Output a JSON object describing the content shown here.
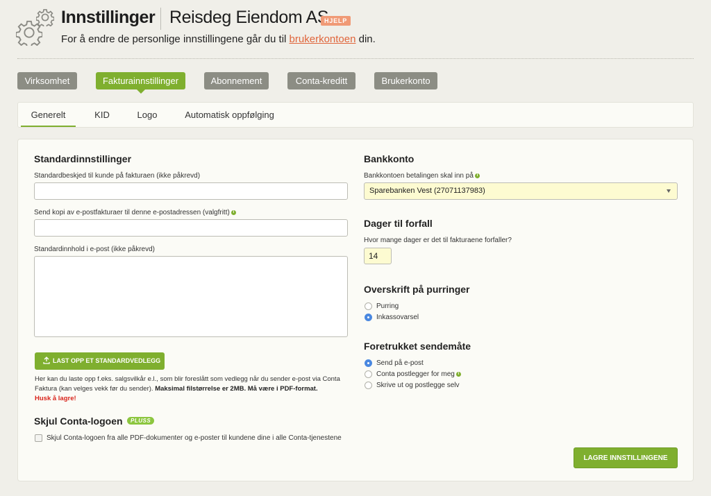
{
  "header": {
    "title": "Innstillinger",
    "company": "Reisdeg Eiendom AS",
    "help_badge": "HJELP",
    "subtitle_before": "For å endre de personlige innstillingene går du til ",
    "subtitle_link": "brukerkontoen",
    "subtitle_after": " din."
  },
  "main_tabs": [
    {
      "label": "Virksomhet",
      "active": false
    },
    {
      "label": "Fakturainnstillinger",
      "active": true
    },
    {
      "label": "Abonnement",
      "active": false
    },
    {
      "label": "Conta-kreditt",
      "active": false
    },
    {
      "label": "Brukerkonto",
      "active": false
    }
  ],
  "sub_tabs": [
    {
      "label": "Generelt",
      "active": true
    },
    {
      "label": "KID",
      "active": false
    },
    {
      "label": "Logo",
      "active": false
    },
    {
      "label": "Automatisk oppfølging",
      "active": false
    }
  ],
  "left": {
    "heading": "Standardinnstillinger",
    "message_label": "Standardbeskjed til kunde på fakturaen (ikke påkrevd)",
    "message_value": "",
    "copy_label": "Send kopi av e-postfakturaer til denne e-postadressen (valgfritt)",
    "copy_value": "",
    "content_label": "Standardinnhold i e-post (ikke påkrevd)",
    "content_value": "",
    "upload_button": "LAST OPP ET STANDARDVEDLEGG",
    "hint_text": "Her kan du laste opp f.eks. salgsvilkår e.l., som blir foreslått som vedlegg når du sender e-post via Conta Faktura (kan velges vekk før du sender). ",
    "hint_bold": "Maksimal filstørrelse er 2MB. Må være i PDF-format.",
    "hint_warn": "Husk å lagre!",
    "hide_logo_heading": "Skjul Conta-logoen",
    "pluss_badge": "PLUSS",
    "hide_logo_checkbox_label": "Skjul Conta-logoen fra alle PDF-dokumenter og e-poster til kundene dine i alle Conta-tjenestene",
    "hide_logo_checked": false
  },
  "right": {
    "bank_heading": "Bankkonto",
    "bank_label": "Bankkontoen betalingen skal inn på",
    "bank_value": "Sparebanken Vest (27071137983)",
    "due_heading": "Dager til forfall",
    "due_label": "Hvor mange dager er det til fakturaene forfaller?",
    "due_value": "14",
    "reminder_heading": "Overskrift på purringer",
    "reminder_options": [
      {
        "label": "Purring",
        "selected": false
      },
      {
        "label": "Inkassovarsel",
        "selected": true
      }
    ],
    "send_heading": "Foretrukket sendemåte",
    "send_options": [
      {
        "label": "Send på e-post",
        "selected": true
      },
      {
        "label": "Conta postlegger for meg",
        "selected": false
      },
      {
        "label": "Skrive ut og postlegge selv",
        "selected": false
      }
    ],
    "save_button": "LAGRE INNSTILLINGENE"
  },
  "colors": {
    "accent_green": "#7faf2f",
    "tab_gray": "#8c8d84",
    "link_orange": "#e0653b",
    "warning_red": "#d9241b",
    "radio_blue": "#4a88e0"
  }
}
